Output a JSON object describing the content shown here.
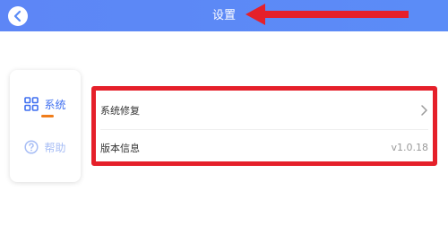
{
  "header": {
    "title": "设置",
    "background": "#5b8cf7"
  },
  "sidebar": {
    "items": [
      {
        "label": "系统",
        "icon": "grid-icon",
        "active": true
      },
      {
        "label": "帮助",
        "icon": "question-circle-icon",
        "active": false
      }
    ],
    "accent": "#f07d1a"
  },
  "panel": {
    "highlight_color": "#e5202a",
    "rows": [
      {
        "label": "系统修复",
        "icon": "chevron-right-icon"
      },
      {
        "label": "版本信息",
        "value": "v1.0.18"
      }
    ]
  }
}
